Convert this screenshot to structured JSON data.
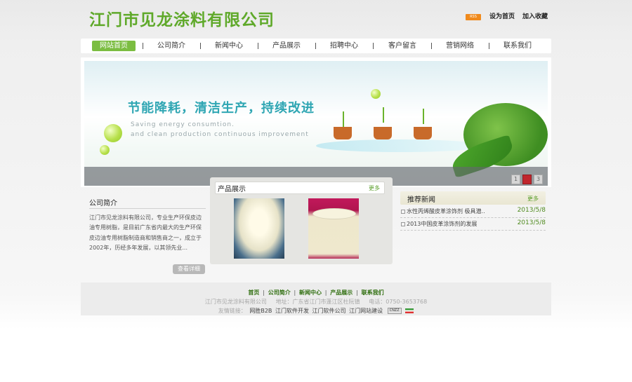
{
  "header": {
    "logo_text": "江门市见龙涂料有限公司",
    "rss_label": "RSS",
    "set_home": "设为首页",
    "add_favorite": "加入收藏"
  },
  "nav": {
    "items": [
      "网站首页",
      "公司简介",
      "新闻中心",
      "产品展示",
      "招聘中心",
      "客户留言",
      "营销网络",
      "联系我们"
    ],
    "active_index": 0
  },
  "banner": {
    "slogan": "节能降耗，清洁生产，持续改进",
    "slogan_en_1": "Saving energy consumtion.",
    "slogan_en_2": "and clean production continuous improvement",
    "pages": [
      "1",
      "2",
      "3"
    ],
    "active_page": "2"
  },
  "about": {
    "title": "公司简介",
    "text": "江门市见龙涂料有限公司，专业生产环保皮边油专用树脂，是目前广东省内最大的生产环保皮边油专用树脂制造商和销售商之一，成立于2002年，历经多年发展，以其领先业...",
    "more": "查看详细"
  },
  "products": {
    "title": "产品展示",
    "more": "更多"
  },
  "news": {
    "title": "推荐新闻",
    "more": "更多",
    "items": [
      {
        "title": "水性丙烯酸皮革涂饰剂 极具潜..",
        "date": "2013/5/8"
      },
      {
        "title": "2013中国皮革涂饰剂的发展",
        "date": "2013/5/8"
      }
    ]
  },
  "footer": {
    "links": [
      "首页",
      "公司简介",
      "新闻中心",
      "产品展示",
      "联系我们"
    ],
    "separator": "|",
    "company": "江门市见龙涂料有限公司",
    "address": "地址：广东省江门市蓬江区杜阮镇",
    "phone": "电话：0750-3653768",
    "friends_label": "友情链接：",
    "friend_links": [
      "网胜B2B",
      "江门软件开发",
      "江门软件公司",
      "江门网站建设"
    ],
    "badge": "CNZZ"
  },
  "colors": {
    "brand_green": "#5fa92a",
    "nav_active": "#7bbd41",
    "active_page_dot": "#c0262d"
  }
}
